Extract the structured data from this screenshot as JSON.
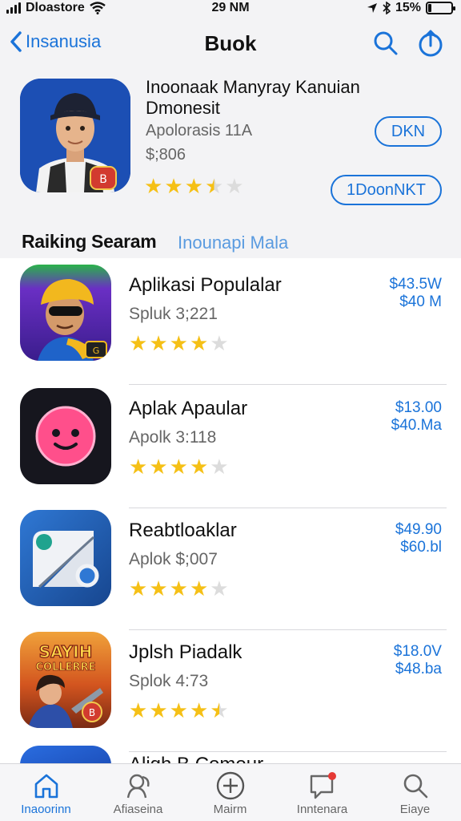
{
  "status_bar": {
    "carrier": "Dloastore",
    "time": "29 NM",
    "battery": "15%",
    "battery_level": 0.15
  },
  "nav": {
    "back_label": "Insanusia",
    "title": "Buok",
    "search_icon": "search-icon",
    "share_icon": "share-icon"
  },
  "hero": {
    "title": "Inoonaak Manyray Kanuian Dmonesit",
    "subtitle": "Apolorasis 11A",
    "price": "$;806",
    "rating": 3.5,
    "get_label": "DKN",
    "download_label": "1DoonNKT"
  },
  "section": {
    "title": "Raiking Searam",
    "link": "Inounapi Mala"
  },
  "apps": [
    {
      "title": "Aplikasi Populalar",
      "subtitle": "Spluk 3;221",
      "price_line1": "$43.5W",
      "price_line2": "$40 M",
      "rating": 4,
      "icon": "hero-cap-icon"
    },
    {
      "title": "Aplak Apaular",
      "subtitle": "Apolk 3:118",
      "price_line1": "$13.00",
      "price_line2": "$40.Ma",
      "rating": 4,
      "icon": "smiley-icon"
    },
    {
      "title": "Reabtloaklar",
      "subtitle": "Aplok $;007",
      "price_line1": "$49.90",
      "price_line2": "$60.bl",
      "rating": 4,
      "icon": "diagonal-shape-icon"
    },
    {
      "title": "Jplsh Piadalk",
      "subtitle": "Splok 4:73",
      "price_line1": "$18.0V",
      "price_line2": "$48.ba",
      "rating": 4.5,
      "icon": "game-adventure-icon",
      "icon_text": "SAYIH COLLERRE"
    }
  ],
  "partial_app": {
    "title": "Aligh B Comour"
  },
  "tabs": [
    {
      "label": "Inaoorinn",
      "icon": "home-icon",
      "active": true
    },
    {
      "label": "Afiaseina",
      "icon": "people-icon",
      "active": false
    },
    {
      "label": "Mairm",
      "icon": "plus-circle-icon",
      "active": false
    },
    {
      "label": "Inntenara",
      "icon": "chat-badge-icon",
      "active": false
    },
    {
      "label": "Eiaye",
      "icon": "search-icon",
      "active": false
    }
  ],
  "colors": {
    "accent": "#1a73d9",
    "star": "#f5c016",
    "star_empty": "#dcdcdc",
    "section_link": "#5a9be0"
  }
}
